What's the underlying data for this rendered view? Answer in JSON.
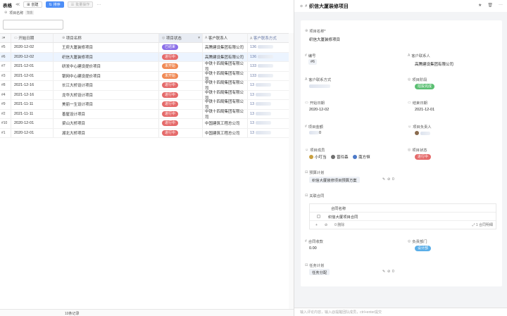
{
  "toolbar": {
    "title": "表格",
    "collapse": "≪",
    "create_label": "创建",
    "sort_label": "排序",
    "batch_label": "批量操作",
    "more": "···"
  },
  "filter": {
    "field_label": "项目名称",
    "tag": "包含"
  },
  "table": {
    "headers": [
      "开始日期",
      "项目名称",
      "项目状态",
      "客户联系人",
      "客户联系方式"
    ],
    "rows": [
      {
        "id": "#5",
        "start": "2020-12-02",
        "name": "王府大厦装修项目",
        "status": "已结束",
        "contact": "高腾建设集团有限公司",
        "phone": "136"
      },
      {
        "id": "#6",
        "start": "2020-12-02",
        "name": "织信大厦装修项目",
        "status": "进行中",
        "contact": "高腾建设集团有限公司",
        "phone": "136"
      },
      {
        "id": "#7",
        "start": "2021-12-01",
        "name": "研发中心建设提价项目",
        "status": "未开始",
        "contact": "中铁十四局集团有限公司",
        "phone": "133"
      },
      {
        "id": "#3",
        "start": "2021-12-01",
        "name": "银网中心建设提价项目",
        "status": "未开始",
        "contact": "中铁十四局集团有限公司",
        "phone": "133"
      },
      {
        "id": "#8",
        "start": "2021-12-16",
        "name": "长江大桥设计项目",
        "status": "进行中",
        "contact": "中铁十四局集团有限公司",
        "phone": "13"
      },
      {
        "id": "#4",
        "start": "2021-12-16",
        "name": "龙华大桥设计项目",
        "status": "进行中",
        "contact": "中铁十四局集团有限公司",
        "phone": "13"
      },
      {
        "id": "#9",
        "start": "2021-11-11",
        "name": "美丽一生设计项目",
        "status": "进行中",
        "contact": "中铁十四局集团有限公司",
        "phone": "13"
      },
      {
        "id": "#2",
        "start": "2021-11-11",
        "name": "善屋设计项目",
        "status": "进行中",
        "contact": "中铁十四局集团有限公司",
        "phone": "13"
      },
      {
        "id": "#10",
        "start": "2020-12-01",
        "name": "梁山大桥项目",
        "status": "进行中",
        "contact": "中国建筑工程总公司",
        "phone": "13"
      },
      {
        "id": "#1",
        "start": "2020-12-01",
        "name": "湖北大桥项目",
        "status": "进行中",
        "contact": "中国建筑工程总公司",
        "phone": "13"
      }
    ],
    "footer": "10条记录"
  },
  "status_colors": {
    "已结束": "#8a6ee8",
    "进行中": "#e56a6a",
    "未开始": "#f08a55"
  },
  "panel": {
    "title": "织信大厦装修项目",
    "fields": {
      "name_label": "项目名称*",
      "name_value": "织信大厦装修项目",
      "code_label": "编号",
      "code_value": "#6",
      "contact_label": "客户联系人",
      "contact_value": "高腾建设集团有限公司",
      "phone_label": "客户联系方式",
      "stage_label": "项目阶段",
      "stage_value": "招投完成",
      "start_label": "开始日期",
      "start_value": "2020-12-02",
      "end_label": "结束日期",
      "end_value": "2021-12-01",
      "amount_label": "项目金额",
      "amount_value": "0",
      "manager_label": "项目负责人",
      "members_label": "项目成员",
      "members": [
        "小叮当",
        "曾玲森",
        "南方恒"
      ],
      "status_label": "项目状态",
      "status_value": "进行中",
      "budget_label": "预算计划",
      "budget_value": "织信大厦装修项目预算方案",
      "budget_count": "0",
      "contract_label": "关联合同",
      "contract_col": "合同名称",
      "contract_row": "织信大厦项目合同",
      "contract_count": "0",
      "contract_delete": "删除",
      "contract_total": "1 合同明细",
      "receivable_label": "合同收款",
      "receivable_value": "0.00",
      "dept_label": "负责部门",
      "dept_value": "设计部",
      "task_label": "任务计划",
      "task_value": "任务分配",
      "task_count": "0"
    },
    "comment_placeholder": "输入评论内容，输入@提醒团队成员，ctrl+enter提交"
  }
}
